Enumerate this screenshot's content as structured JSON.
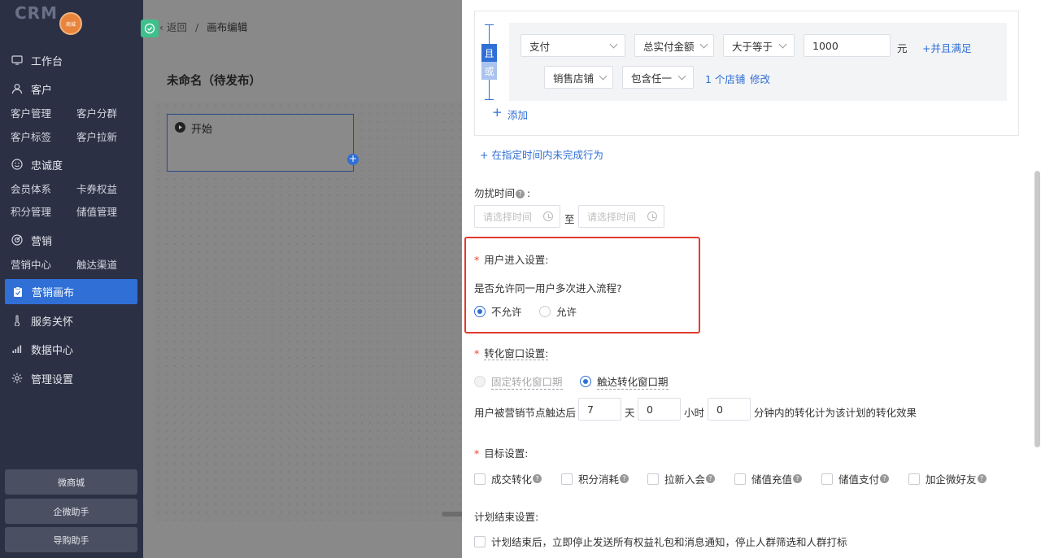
{
  "sidebar": {
    "logo_text": "CRM",
    "badge_text": "商城",
    "groups": {
      "workbench": "工作台",
      "customer": "客户",
      "loyalty": "忠诚度",
      "marketing": "营销",
      "service": "服务关怀",
      "data": "数据中心",
      "admin": "管理设置"
    },
    "subs": {
      "customer_mgmt": "客户管理",
      "customer_group": "客户分群",
      "customer_tag": "客户标签",
      "customer_acquire": "客户拉新",
      "member_system": "会员体系",
      "coupon_rights": "卡券权益",
      "points_mgmt": "积分管理",
      "stored_value": "储值管理",
      "marketing_center": "营销中心",
      "touch_channel": "触达渠道"
    },
    "active_item": "营销画布",
    "bottom_buttons": [
      "微商城",
      "企微助手",
      "导购助手"
    ]
  },
  "canvas": {
    "breadcrumb_back": "返回",
    "breadcrumb_sep": "/",
    "breadcrumb_current": "画布编辑",
    "page_title": "未命名（待发布）",
    "start_node": "开始"
  },
  "panel": {
    "and_label": "且",
    "or_label": "或",
    "row1": {
      "behavior": "支付",
      "metric": "总实付金额",
      "operator": "大于等于",
      "value": "1000",
      "unit": "元",
      "add_and": "+并且满足"
    },
    "row2": {
      "scope": "销售店铺",
      "match": "包含任一",
      "count_text": "1 个店铺",
      "edit": "修改"
    },
    "add_label": "添加",
    "add_time_behavior": "+ 在指定时间内未完成行为",
    "dnd_label": "勿扰时间",
    "dnd_colon": ":",
    "time_placeholder_start": "请选择时间",
    "time_to": "至",
    "time_placeholder_end": "请选择时间",
    "user_entry": {
      "title": "用户进入设置:",
      "question": "是否允许同一用户多次进入流程?",
      "options": [
        "不允许",
        "允许"
      ],
      "selected": "不允许"
    },
    "conversion": {
      "title": "转化窗口设置:",
      "options": [
        "固定转化窗口期",
        "触达转化窗口期"
      ],
      "selected": "触达转化窗口期",
      "prefix": "用户被营销节点触达后",
      "days": "7",
      "day_unit": "天",
      "hours": "0",
      "hour_unit": "小时",
      "minutes": "0",
      "suffix": "分钟内的转化计为该计划的转化效果"
    },
    "goals": {
      "title": "目标设置:",
      "items": [
        "成交转化",
        "积分消耗",
        "拉新入会",
        "储值充值",
        "储值支付",
        "加企微好友"
      ]
    },
    "plan_end": {
      "title": "计划结束设置:",
      "option": "计划结束后，立即停止发送所有权益礼包和消息通知，停止人群筛选和人群打标"
    },
    "help_glyph": "?",
    "plus_glyph": "+"
  }
}
